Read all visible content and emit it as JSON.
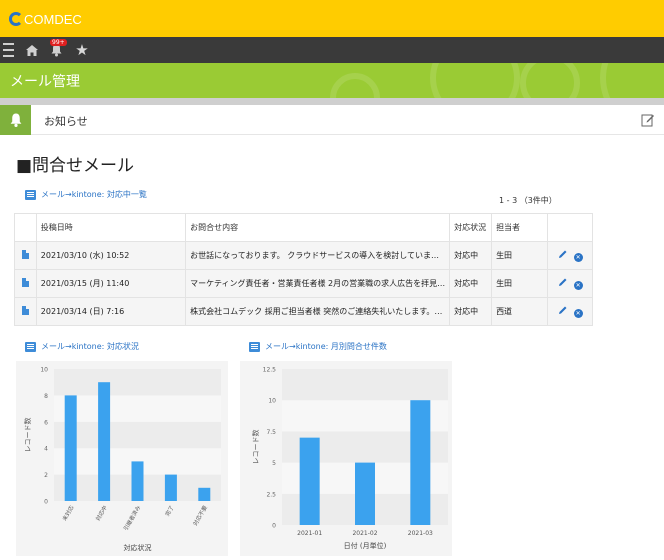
{
  "header": {
    "logo_text": "COMDEC",
    "bell_badge": "99+"
  },
  "title": "メール管理",
  "notice": {
    "label": "お知らせ"
  },
  "section_title": "■問合せメール",
  "list_link": "メール→kintone: 対応中一覧",
  "pager": "1 - 3  （3件中）",
  "table": {
    "columns": [
      "",
      "投稿日時",
      "お問合せ内容",
      "対応状況",
      "担当者",
      ""
    ],
    "rows": [
      {
        "date": "2021/03/10 (水) 10:52",
        "content": "お世話になっております。 クラウドサービスの導入を検討していま…",
        "status": "対応中",
        "assignee": "生田"
      },
      {
        "date": "2021/03/15 (月) 11:40",
        "content": "マーケティング責任者・営業責任者様 2月の営業職の求人広告を拝見…",
        "status": "対応中",
        "assignee": "生田"
      },
      {
        "date": "2021/03/14 (日) 7:16",
        "content": "株式会社コムデック 採用ご担当者様 突然のご連絡失礼いたします。…",
        "status": "対応中",
        "assignee": "西道"
      }
    ]
  },
  "chart_links": {
    "left": "メール→kintone: 対応状況",
    "right": "メール→kintone: 月別問合せ件数"
  },
  "chart_data": [
    {
      "type": "bar",
      "categories": [
        "未対応",
        "対応中",
        "引継者済み",
        "完了",
        "対応不要"
      ],
      "values": [
        8,
        9,
        3,
        2,
        1
      ],
      "xlabel": "対応状況",
      "ylabel": "レコード数",
      "yticks": [
        "0",
        "2",
        "4",
        "6",
        "8",
        "10"
      ],
      "ylim": [
        0,
        10
      ],
      "color": "#3ba2ee",
      "grid": true
    },
    {
      "type": "bar",
      "categories": [
        "2021-01",
        "2021-02",
        "2021-03"
      ],
      "values": [
        7,
        5,
        10
      ],
      "xlabel": "日付 (月単位)",
      "ylabel": "レコード数",
      "yticks": [
        "0",
        "2.5",
        "5",
        "7.5",
        "10",
        "12.5"
      ],
      "ylim": [
        0,
        12.5
      ],
      "color": "#3ba2ee",
      "grid": true
    }
  ]
}
